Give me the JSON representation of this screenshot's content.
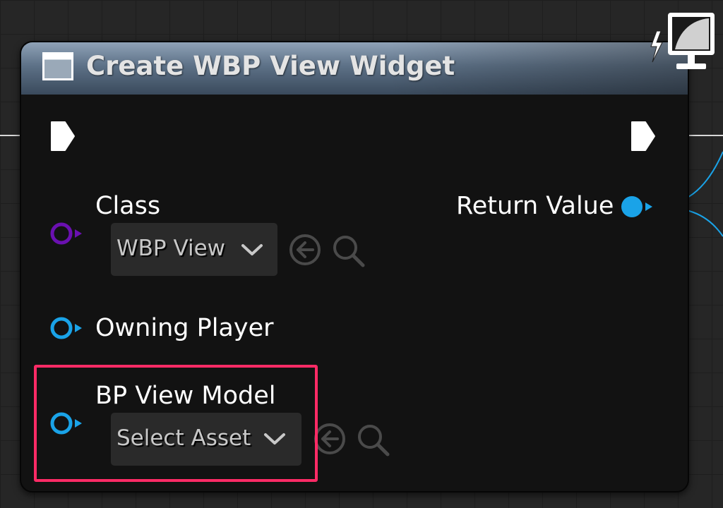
{
  "node": {
    "title": "Create WBP View Widget",
    "header_icon": "widget-window-icon",
    "corner_icon": "monitor-lightning-icon"
  },
  "pins": {
    "exec_in": "exec-in-arrow-icon",
    "exec_out": "exec-out-arrow-icon",
    "class": {
      "label": "Class",
      "value": "WBP View",
      "color": "#6a10b0"
    },
    "owning_player": {
      "label": "Owning Player",
      "color": "#1aa3e8"
    },
    "bp_view_model": {
      "label": "BP View Model",
      "value": "Select Asset",
      "color": "#1aa3e8"
    },
    "return_value": {
      "label": "Return Value",
      "color": "#1aa3e8"
    }
  },
  "tools": {
    "use_selected": "arrow-left-circle-icon",
    "browse": "search-icon"
  },
  "highlight": {
    "color": "#ff2b66"
  }
}
